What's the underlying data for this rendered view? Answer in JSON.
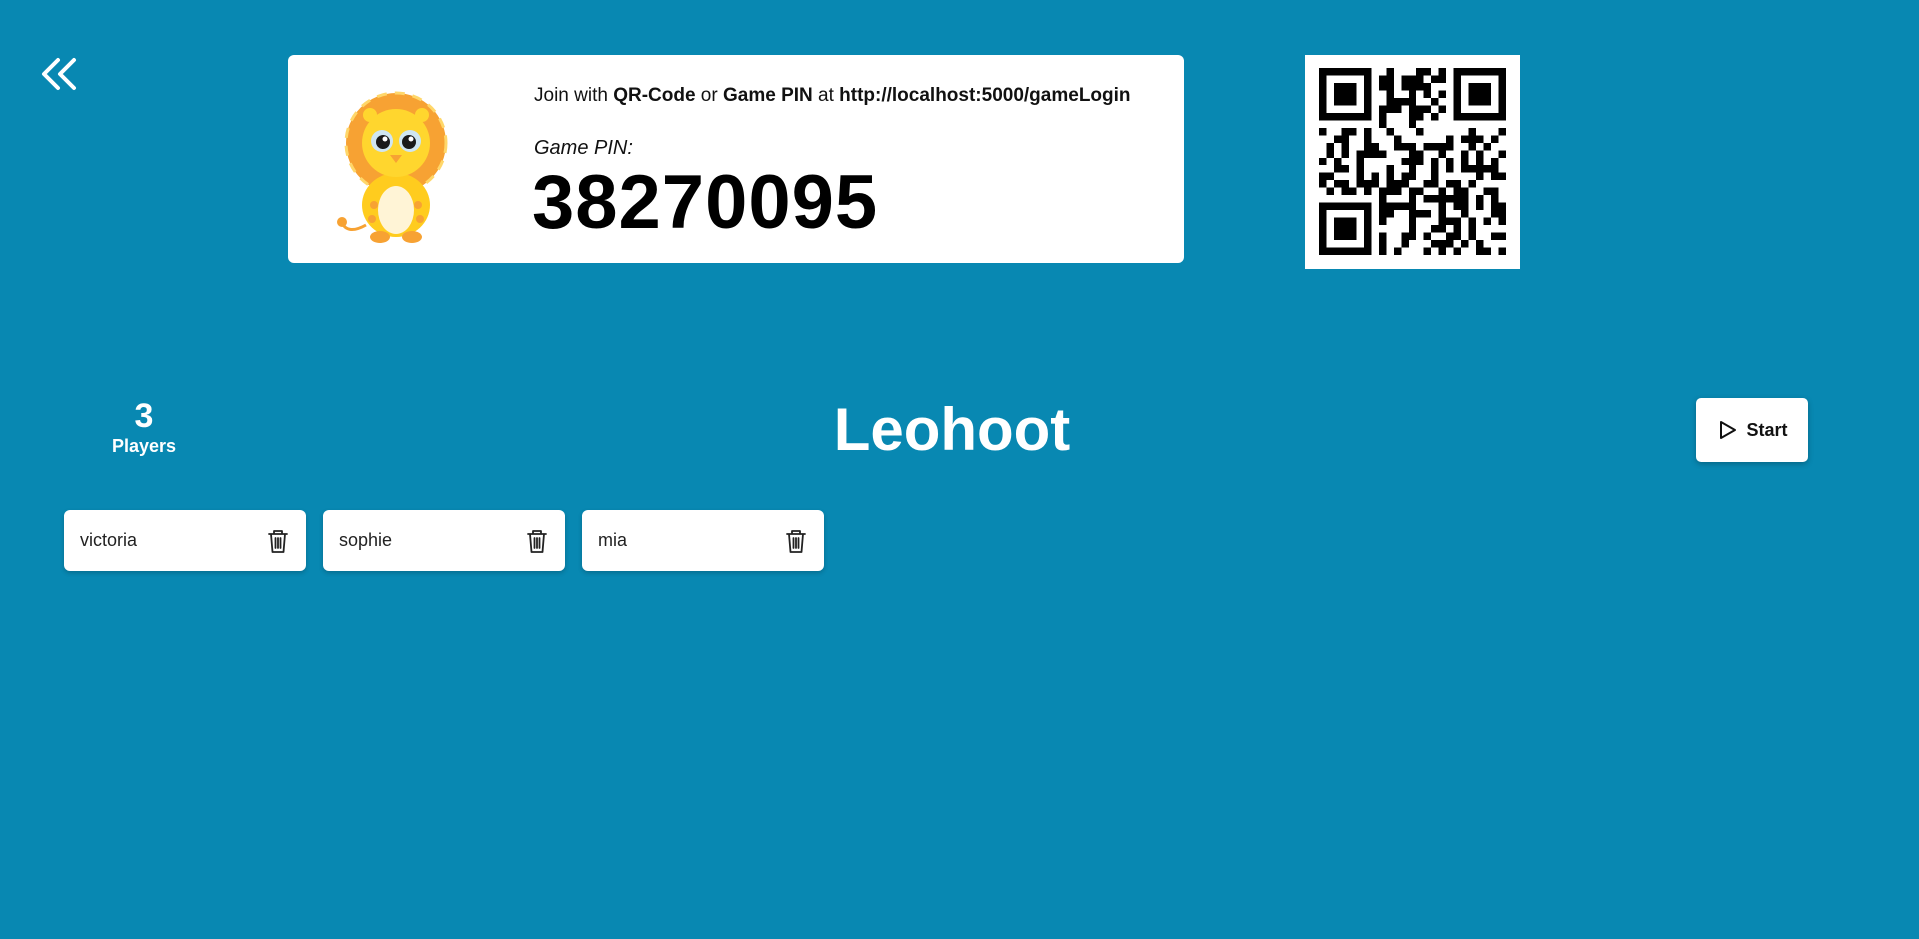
{
  "header": {
    "back_icon": "double-chevron-left-icon"
  },
  "join_card": {
    "mascot": "lion-mascot",
    "join_prefix": "Join with ",
    "join_qr": "QR-Code",
    "join_or": " or ",
    "join_pin": "Game PIN",
    "join_at": " at ",
    "join_url": "http://localhost:5000/gameLogin",
    "pin_caption": "Game PIN:",
    "pin_value": "38270095"
  },
  "qr": {
    "icon": "qr-code"
  },
  "lobby": {
    "player_count": "3",
    "players_label": "Players",
    "title": "Leohoot",
    "start_label": "Start",
    "start_icon": "play-icon"
  },
  "players": [
    {
      "name": "victoria"
    },
    {
      "name": "sophie"
    },
    {
      "name": "mia"
    }
  ],
  "colors": {
    "background": "#0888b2",
    "card": "#ffffff"
  }
}
